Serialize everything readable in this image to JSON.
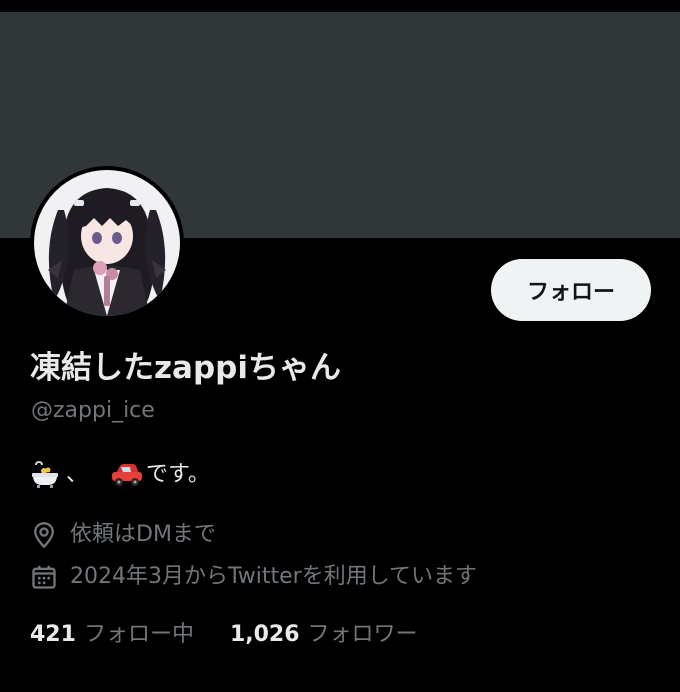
{
  "profile": {
    "display_name": "凍結したzappiちゃん",
    "handle": "@zappi_ice",
    "bio": {
      "emoji_1": "bathtub",
      "separator": "、",
      "emoji_2": "red car",
      "text": "です。"
    },
    "location": "依頼はDMまで",
    "joined": "2024年3月からTwitterを利用しています",
    "avatar": "anime-girl-avatar"
  },
  "actions": {
    "follow_label": "フォロー"
  },
  "stats": {
    "following_count": "421",
    "following_label": "フォロー中",
    "followers_count": "1,026",
    "followers_label": "フォロワー"
  },
  "icons": {
    "location": "location-pin-icon",
    "calendar": "calendar-icon"
  },
  "colors": {
    "background": "#000000",
    "banner": "#313639",
    "text_primary": "#e7e9ea",
    "text_secondary": "#71767b",
    "button_bg": "#eff3f4",
    "button_text": "#0f1419"
  }
}
